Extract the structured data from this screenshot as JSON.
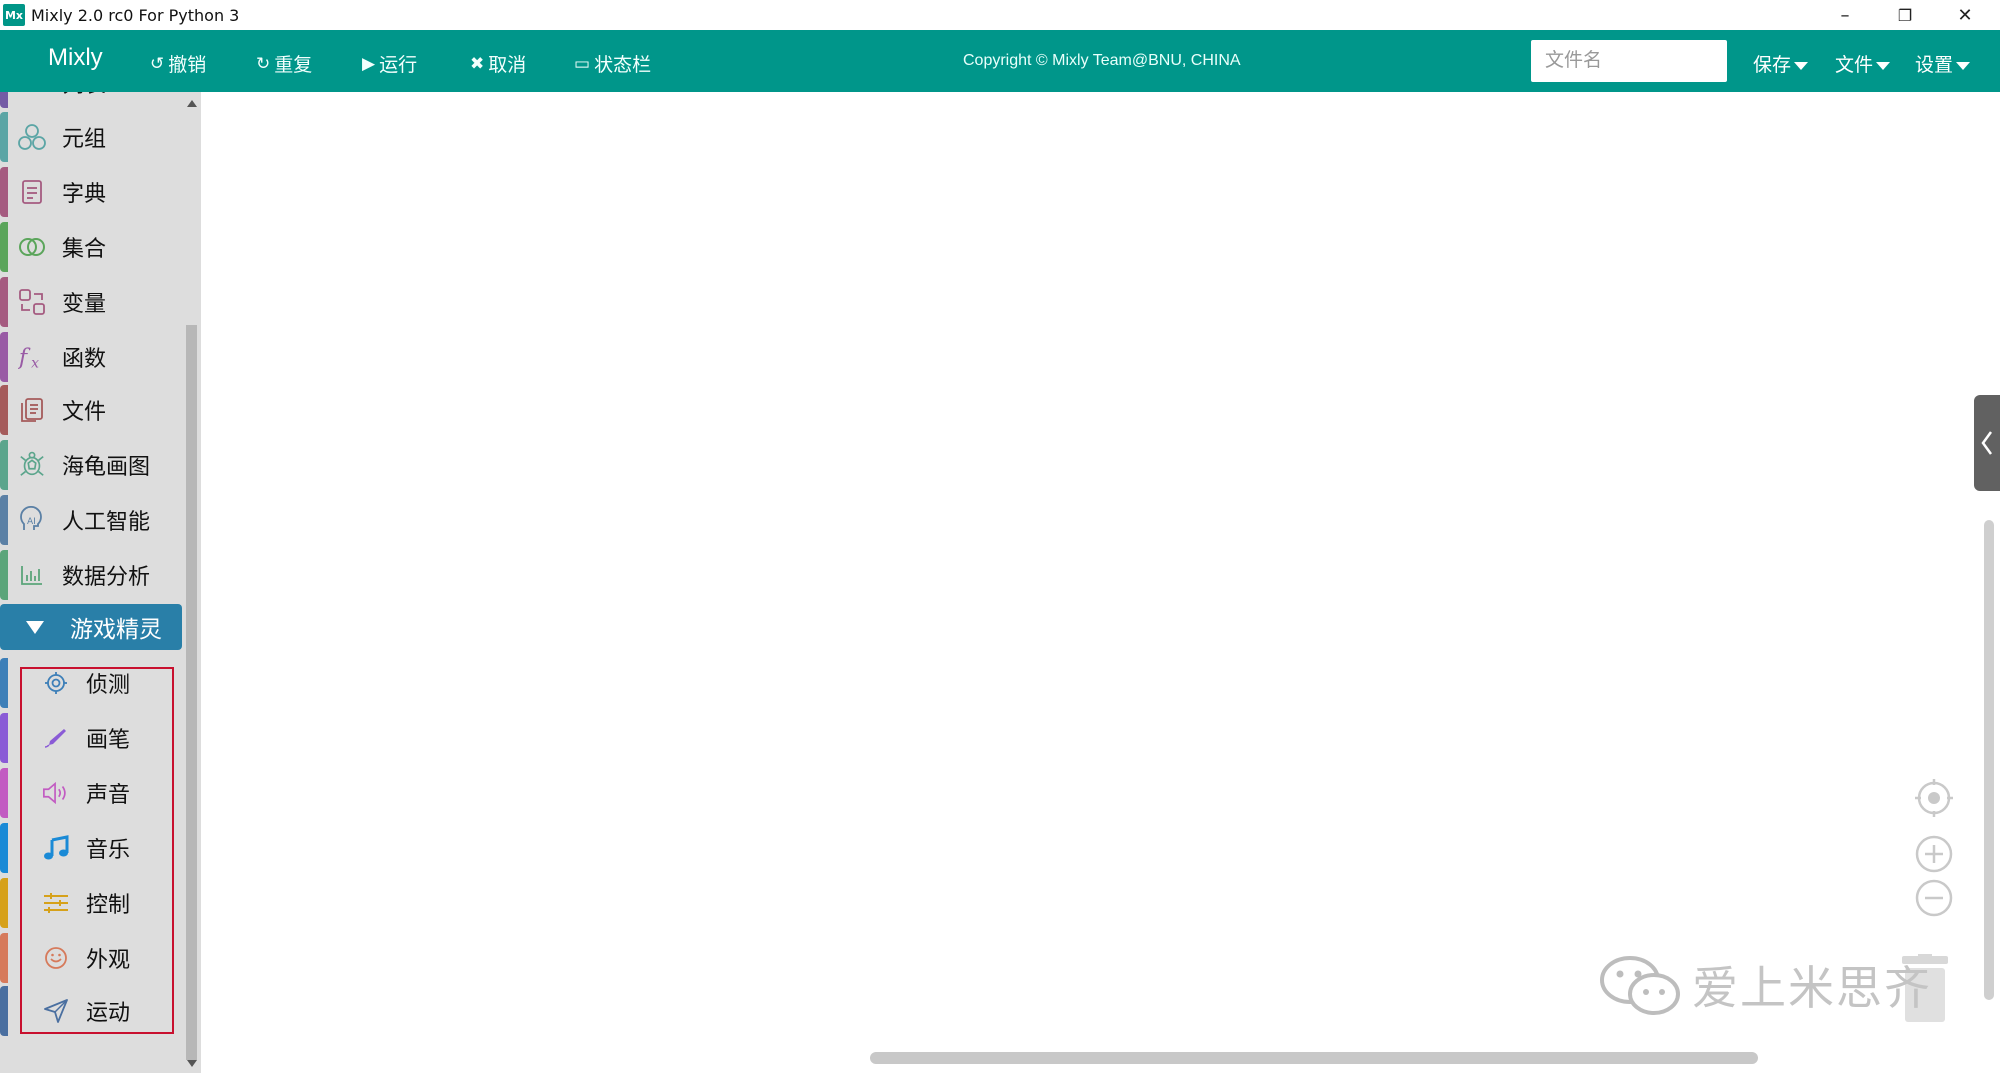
{
  "window": {
    "icon_text": "Mx",
    "title": "Mixly 2.0 rc0 For Python 3",
    "minimize": "–",
    "maximize": "❐",
    "close": "✕"
  },
  "toolbar": {
    "brand": "Mixly",
    "undo": "撤销",
    "redo": "重复",
    "run": "运行",
    "cancel": "取消",
    "statusbar": "状态栏",
    "copyright": "Copyright © Mixly Team@BNU, CHINA",
    "filename_placeholder": "文件名",
    "save": "保存",
    "file": "文件",
    "settings": "设置"
  },
  "sidebar": {
    "categories": [
      {
        "label": "列表",
        "icon": "list-icon",
        "color": "#745ba5"
      },
      {
        "label": "元组",
        "icon": "tuple-icon",
        "color": "#5ba5a5"
      },
      {
        "label": "字典",
        "icon": "dict-icon",
        "color": "#a55b80"
      },
      {
        "label": "集合",
        "icon": "set-icon",
        "color": "#5ba55b"
      },
      {
        "label": "变量",
        "icon": "variable-icon",
        "color": "#a55b80"
      },
      {
        "label": "函数",
        "icon": "function-icon",
        "color": "#995ba5"
      },
      {
        "label": "文件",
        "icon": "file-icon",
        "color": "#a55b5b"
      },
      {
        "label": "海龟画图",
        "icon": "turtle-icon",
        "color": "#5ba58c"
      },
      {
        "label": "人工智能",
        "icon": "ai-icon",
        "color": "#5b80a5"
      },
      {
        "label": "数据分析",
        "icon": "chart-icon",
        "color": "#5ba57a"
      }
    ],
    "game_category": "游戏精灵",
    "game_subcategories": [
      {
        "label": "侦测",
        "icon": "detect-icon",
        "color": "#3d7fb8"
      },
      {
        "label": "画笔",
        "icon": "pen-icon",
        "color": "#8a5bd6"
      },
      {
        "label": "声音",
        "icon": "sound-icon",
        "color": "#c25bc2"
      },
      {
        "label": "音乐",
        "icon": "music-icon",
        "color": "#1a8ad6"
      },
      {
        "label": "控制",
        "icon": "control-icon",
        "color": "#d6a11a"
      },
      {
        "label": "外观",
        "icon": "looks-icon",
        "color": "#d67a5b"
      },
      {
        "label": "运动",
        "icon": "motion-icon",
        "color": "#4a6fa0"
      }
    ]
  },
  "watermark": "爱上米思齐"
}
